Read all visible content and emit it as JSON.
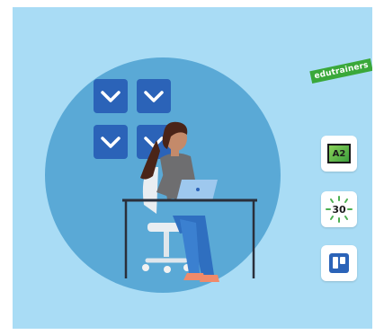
{
  "brand": {
    "label": "edutrainers",
    "color": "#3aa83a"
  },
  "colors": {
    "background": "#a9dcf5",
    "circle": "#5aa9d6",
    "checkbox": "#2b63b8"
  },
  "checkboxes": [
    {
      "icon": "check-icon",
      "checked": true
    },
    {
      "icon": "check-icon",
      "checked": true
    },
    {
      "icon": "check-icon",
      "checked": true
    },
    {
      "icon": "check-icon",
      "checked": true
    }
  ],
  "side_tiles": [
    {
      "icon": "a2-level-icon",
      "label": "A2"
    },
    {
      "icon": "timer-30-icon",
      "label": "30"
    },
    {
      "icon": "board-app-icon",
      "label": ""
    }
  ]
}
